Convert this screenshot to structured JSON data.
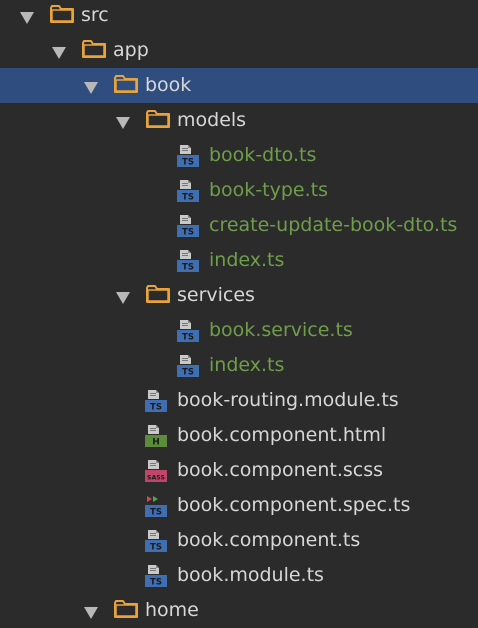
{
  "file_tree": {
    "items": [
      {
        "label": "src",
        "type": "folder",
        "expanded": true,
        "level": 0,
        "selected": false
      },
      {
        "label": "app",
        "type": "folder",
        "expanded": true,
        "level": 1,
        "selected": false
      },
      {
        "label": "book",
        "type": "folder",
        "expanded": true,
        "level": 2,
        "selected": true
      },
      {
        "label": "models",
        "type": "folder",
        "expanded": true,
        "level": 3,
        "selected": false
      },
      {
        "label": "book-dto.ts",
        "type": "file",
        "icon": "ts",
        "level": 4,
        "modified": true
      },
      {
        "label": "book-type.ts",
        "type": "file",
        "icon": "ts",
        "level": 4,
        "modified": true
      },
      {
        "label": "create-update-book-dto.ts",
        "type": "file",
        "icon": "ts",
        "level": 4,
        "modified": true
      },
      {
        "label": "index.ts",
        "type": "file",
        "icon": "ts",
        "level": 4,
        "modified": true
      },
      {
        "label": "services",
        "type": "folder",
        "expanded": true,
        "level": 3,
        "selected": false
      },
      {
        "label": "book.service.ts",
        "type": "file",
        "icon": "ts",
        "level": 4,
        "modified": true
      },
      {
        "label": "index.ts",
        "type": "file",
        "icon": "ts",
        "level": 4,
        "modified": true
      },
      {
        "label": "book-routing.module.ts",
        "type": "file",
        "icon": "ts",
        "level": 3,
        "modified": false
      },
      {
        "label": "book.component.html",
        "type": "file",
        "icon": "html",
        "level": 3,
        "modified": false
      },
      {
        "label": "book.component.scss",
        "type": "file",
        "icon": "sass",
        "level": 3,
        "modified": false
      },
      {
        "label": "book.component.spec.ts",
        "type": "file",
        "icon": "spec",
        "level": 3,
        "modified": false
      },
      {
        "label": "book.component.ts",
        "type": "file",
        "icon": "ts",
        "level": 3,
        "modified": false
      },
      {
        "label": "book.module.ts",
        "type": "file",
        "icon": "ts",
        "level": 3,
        "modified": false
      },
      {
        "label": "home",
        "type": "folder",
        "expanded": true,
        "level": 2,
        "selected": false
      }
    ]
  },
  "icon_badges": {
    "ts": "TS",
    "html": "H",
    "sass": "SASS"
  },
  "colors": {
    "background": "#2b2b2b",
    "selection": "#2f4d7f",
    "modified_text": "#6f9e4a",
    "default_text": "#d7d7d7",
    "folder": "#e8a33d",
    "ts_badge": "#3f6eb3",
    "html_badge": "#5a8c3a",
    "sass_badge": "#c0476b"
  }
}
